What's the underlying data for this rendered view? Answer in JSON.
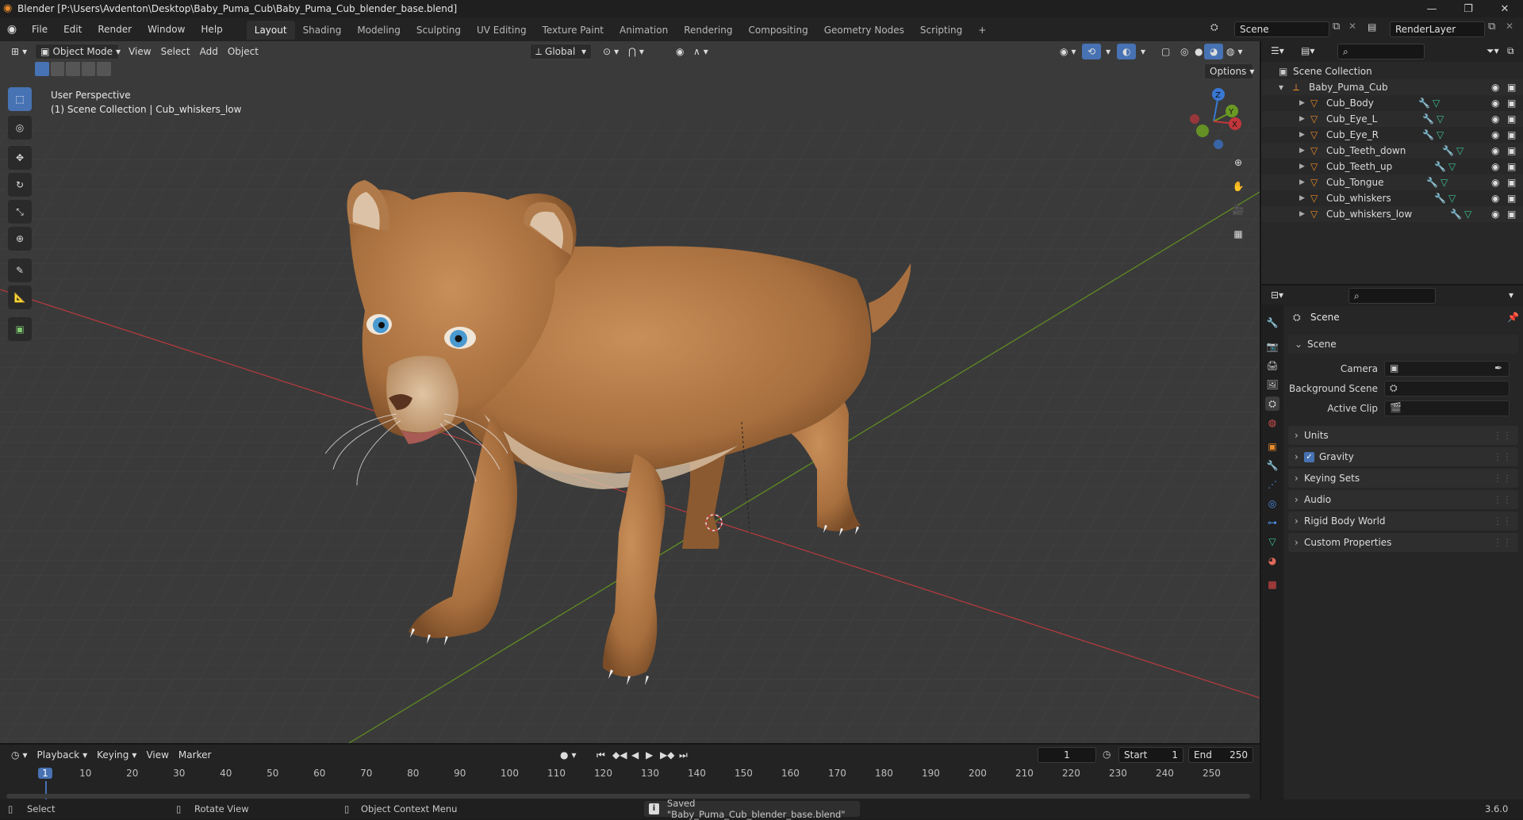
{
  "window": {
    "title": "Blender [P:\\Users\\Avdenton\\Desktop\\Baby_Puma_Cub\\Baby_Puma_Cub_blender_base.blend]",
    "buttons": [
      "—",
      "❐",
      "✕"
    ]
  },
  "menubar": {
    "menus": [
      "File",
      "Edit",
      "Render",
      "Window",
      "Help"
    ],
    "workspaces": [
      "Layout",
      "Shading",
      "Modeling",
      "Sculpting",
      "UV Editing",
      "Texture Paint",
      "Animation",
      "Rendering",
      "Compositing",
      "Geometry Nodes",
      "Scripting"
    ],
    "active_workspace": "Layout",
    "scene": "Scene",
    "view_layer": "RenderLayer"
  },
  "viewport": {
    "mode": "Object Mode",
    "menus": [
      "View",
      "Select",
      "Add",
      "Object"
    ],
    "orientation": "Global",
    "options_label": "Options",
    "overlay_line1": "User Perspective",
    "overlay_line2": "(1) Scene Collection | Cub_whiskers_low",
    "gizmo_axes": [
      "Z",
      "Y",
      "X"
    ],
    "colors": {
      "x_axis": "#c1363a",
      "y_axis": "#6a9a23",
      "z_axis": "#3978d4",
      "active_tool": "#4772b3"
    }
  },
  "outliner": {
    "root": "Scene Collection",
    "collection": "Baby_Puma_Cub",
    "objects": [
      "Cub_Body",
      "Cub_Eye_L",
      "Cub_Eye_R",
      "Cub_Teeth_down",
      "Cub_Teeth_up",
      "Cub_Tongue",
      "Cub_whiskers",
      "Cub_whiskers_low"
    ]
  },
  "properties": {
    "context_title": "Scene",
    "section": "Scene",
    "labels": {
      "camera": "Camera",
      "background": "Background Scene",
      "clip": "Active Clip"
    },
    "panels": [
      "Units",
      "Gravity",
      "Keying Sets",
      "Audio",
      "Rigid Body World",
      "Custom Properties"
    ],
    "gravity_checked": true
  },
  "timeline": {
    "menus": [
      "Playback",
      "Keying",
      "View",
      "Marker"
    ],
    "current_frame": "1",
    "start_label": "Start",
    "start": "1",
    "end_label": "End",
    "end": "250",
    "ruler": [
      "1",
      "10",
      "20",
      "30",
      "40",
      "50",
      "60",
      "70",
      "80",
      "90",
      "100",
      "110",
      "120",
      "130",
      "140",
      "150",
      "160",
      "170",
      "180",
      "190",
      "200",
      "210",
      "220",
      "230",
      "240",
      "250"
    ]
  },
  "statusbar": {
    "select": "Select",
    "rotate": "Rotate View",
    "context": "Object Context Menu",
    "message": "Saved \"Baby_Puma_Cub_blender_base.blend\"",
    "version": "3.6.0"
  }
}
